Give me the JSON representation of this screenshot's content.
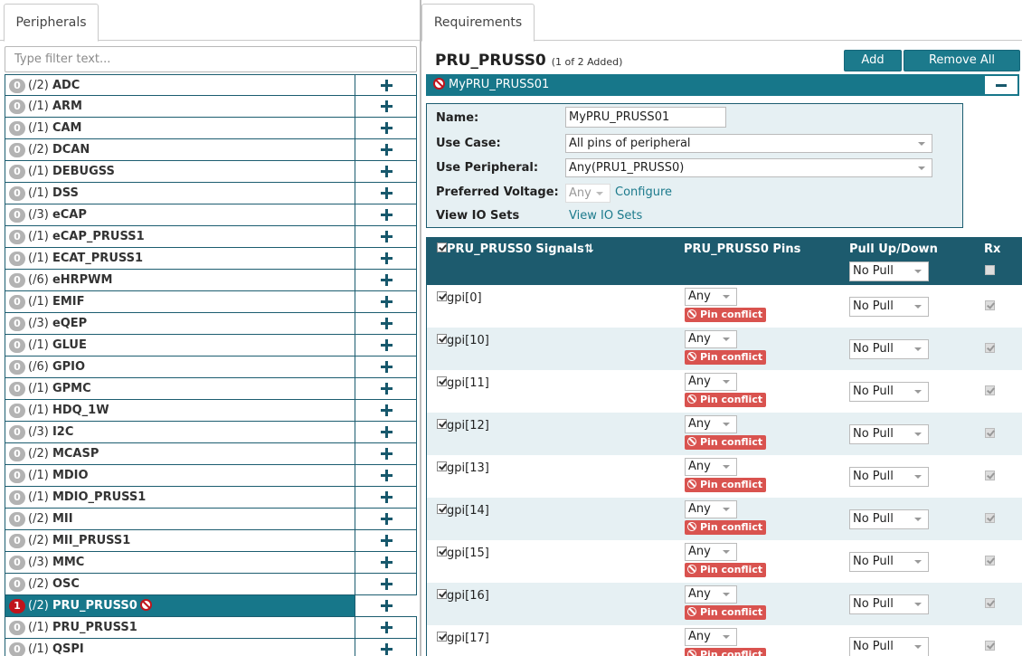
{
  "left_tab": "Peripherals",
  "filter_placeholder": "Type filter text...",
  "peripherals": [
    {
      "added": "0",
      "count": "(/2)",
      "name": "ADC"
    },
    {
      "added": "0",
      "count": "(/1)",
      "name": "ARM"
    },
    {
      "added": "0",
      "count": "(/1)",
      "name": "CAM"
    },
    {
      "added": "0",
      "count": "(/2)",
      "name": "DCAN"
    },
    {
      "added": "0",
      "count": "(/1)",
      "name": "DEBUGSS"
    },
    {
      "added": "0",
      "count": "(/1)",
      "name": "DSS"
    },
    {
      "added": "0",
      "count": "(/3)",
      "name": "eCAP"
    },
    {
      "added": "0",
      "count": "(/1)",
      "name": "eCAP_PRUSS1"
    },
    {
      "added": "0",
      "count": "(/1)",
      "name": "ECAT_PRUSS1"
    },
    {
      "added": "0",
      "count": "(/6)",
      "name": "eHRPWM"
    },
    {
      "added": "0",
      "count": "(/1)",
      "name": "EMIF"
    },
    {
      "added": "0",
      "count": "(/3)",
      "name": "eQEP"
    },
    {
      "added": "0",
      "count": "(/1)",
      "name": "GLUE"
    },
    {
      "added": "0",
      "count": "(/6)",
      "name": "GPIO"
    },
    {
      "added": "0",
      "count": "(/1)",
      "name": "GPMC"
    },
    {
      "added": "0",
      "count": "(/1)",
      "name": "HDQ_1W"
    },
    {
      "added": "0",
      "count": "(/3)",
      "name": "I2C"
    },
    {
      "added": "0",
      "count": "(/2)",
      "name": "MCASP"
    },
    {
      "added": "0",
      "count": "(/1)",
      "name": "MDIO"
    },
    {
      "added": "0",
      "count": "(/1)",
      "name": "MDIO_PRUSS1"
    },
    {
      "added": "0",
      "count": "(/2)",
      "name": "MII"
    },
    {
      "added": "0",
      "count": "(/2)",
      "name": "MII_PRUSS1"
    },
    {
      "added": "0",
      "count": "(/3)",
      "name": "MMC"
    },
    {
      "added": "0",
      "count": "(/2)",
      "name": "OSC"
    },
    {
      "added": "1",
      "count": "(/2)",
      "name": "PRU_PRUSS0",
      "selected": true,
      "warning": true
    },
    {
      "added": "0",
      "count": "(/1)",
      "name": "PRU_PRUSS1"
    },
    {
      "added": "0",
      "count": "(/1)",
      "name": "QSPI"
    }
  ],
  "right_tab": "Requirements",
  "req": {
    "title": "PRU_PRUSS0",
    "subtitle": "(1 of 2 Added)",
    "add_label": "Add",
    "remove_all_label": "Remove All",
    "instance_name": "MyPRU_PRUSS01"
  },
  "form": {
    "name_label": "Name:",
    "name_value": "MyPRU_PRUSS01",
    "usecase_label": "Use Case:",
    "usecase_value": "All pins of peripheral",
    "useperiph_label": "Use Peripheral:",
    "useperiph_value": "Any(PRU1_PRUSS0)",
    "voltage_label": "Preferred Voltage:",
    "voltage_value": "Any",
    "configure_link": "Configure",
    "iosets_label": "View IO Sets",
    "iosets_link": "View IO Sets"
  },
  "signals_table": {
    "col_signals": "PRU_PRUSS0 Signals",
    "sort_glyph": "⇅",
    "col_pins": "PRU_PRUSS0 Pins",
    "col_pull": "Pull Up/Down",
    "col_rx": "Rx",
    "header_pull_value": "No Pull",
    "rows": [
      {
        "signal": "gpi[0]",
        "pin": "Any",
        "conflict": "Pin conflict",
        "pull": "No Pull"
      },
      {
        "signal": "gpi[10]",
        "pin": "Any",
        "conflict": "Pin conflict",
        "pull": "No Pull"
      },
      {
        "signal": "gpi[11]",
        "pin": "Any",
        "conflict": "Pin conflict",
        "pull": "No Pull"
      },
      {
        "signal": "gpi[12]",
        "pin": "Any",
        "conflict": "Pin conflict",
        "pull": "No Pull"
      },
      {
        "signal": "gpi[13]",
        "pin": "Any",
        "conflict": "Pin conflict",
        "pull": "No Pull"
      },
      {
        "signal": "gpi[14]",
        "pin": "Any",
        "conflict": "Pin conflict",
        "pull": "No Pull"
      },
      {
        "signal": "gpi[15]",
        "pin": "Any",
        "conflict": "Pin conflict",
        "pull": "No Pull"
      },
      {
        "signal": "gpi[16]",
        "pin": "Any",
        "conflict": "Pin conflict",
        "pull": "No Pull"
      },
      {
        "signal": "gpi[17]",
        "pin": "Any",
        "conflict": "Pin conflict",
        "pull": "No Pull"
      }
    ]
  },
  "colors": {
    "accent": "#17778a",
    "header": "#1d5b6e",
    "conflict": "#d9534f",
    "error_badge": "#c0141c",
    "form_bg": "#e6f0f3"
  }
}
